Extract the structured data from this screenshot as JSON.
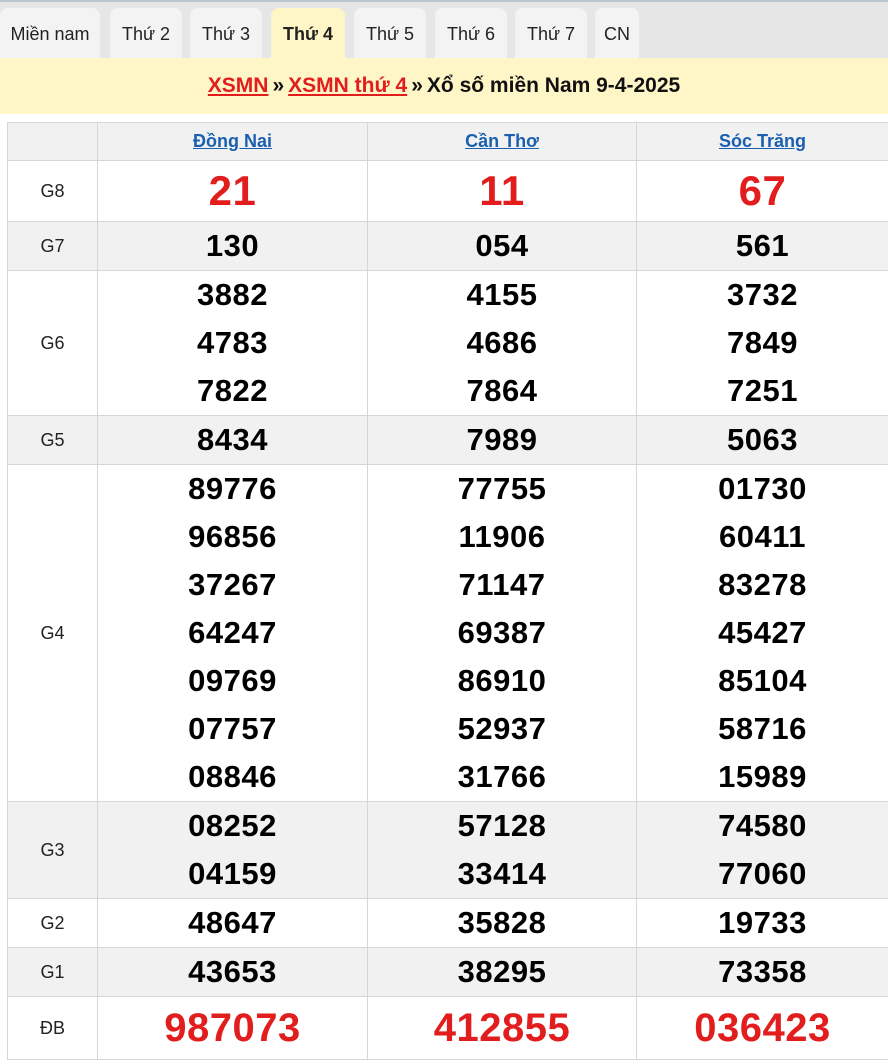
{
  "tabs": [
    {
      "label": "Miền nam",
      "active": false
    },
    {
      "label": "Thứ 2",
      "active": false
    },
    {
      "label": "Thứ 3",
      "active": false
    },
    {
      "label": "Thứ 4",
      "active": true
    },
    {
      "label": "Thứ 5",
      "active": false
    },
    {
      "label": "Thứ 6",
      "active": false
    },
    {
      "label": "Thứ 7",
      "active": false
    },
    {
      "label": "CN",
      "active": false
    }
  ],
  "title": {
    "link1": "XSMN",
    "sep1": "»",
    "link2": "XSMN thứ 4",
    "sep2": "»",
    "text": "Xổ số miền Nam 9-4-2025"
  },
  "provinces": [
    "Đồng Nai",
    "Cần Thơ",
    "Sóc Trăng"
  ],
  "prizes": [
    {
      "label": "G8",
      "style": "big-red",
      "values": [
        [
          "21"
        ],
        [
          "11"
        ],
        [
          "67"
        ]
      ]
    },
    {
      "label": "G7",
      "style": "normal",
      "values": [
        [
          "130"
        ],
        [
          "054"
        ],
        [
          "561"
        ]
      ]
    },
    {
      "label": "G6",
      "style": "normal",
      "values": [
        [
          "3882",
          "4783",
          "7822"
        ],
        [
          "4155",
          "4686",
          "7864"
        ],
        [
          "3732",
          "7849",
          "7251"
        ]
      ]
    },
    {
      "label": "G5",
      "style": "normal",
      "values": [
        [
          "8434"
        ],
        [
          "7989"
        ],
        [
          "5063"
        ]
      ]
    },
    {
      "label": "G4",
      "style": "normal",
      "values": [
        [
          "89776",
          "96856",
          "37267",
          "64247",
          "09769",
          "07757",
          "08846"
        ],
        [
          "77755",
          "11906",
          "71147",
          "69387",
          "86910",
          "52937",
          "31766"
        ],
        [
          "01730",
          "60411",
          "83278",
          "45427",
          "85104",
          "58716",
          "15989"
        ]
      ]
    },
    {
      "label": "G3",
      "style": "normal",
      "values": [
        [
          "08252",
          "04159"
        ],
        [
          "57128",
          "33414"
        ],
        [
          "74580",
          "77060"
        ]
      ]
    },
    {
      "label": "G2",
      "style": "normal",
      "values": [
        [
          "48647"
        ],
        [
          "35828"
        ],
        [
          "19733"
        ]
      ]
    },
    {
      "label": "G1",
      "style": "normal",
      "values": [
        [
          "43653"
        ],
        [
          "38295"
        ],
        [
          "73358"
        ]
      ]
    },
    {
      "label": "ĐB",
      "style": "huge-red",
      "values": [
        [
          "987073"
        ],
        [
          "412855"
        ],
        [
          "036423"
        ]
      ]
    }
  ],
  "colors": {
    "accent_red": "#e21d1d",
    "link_blue": "#1a5fb0",
    "title_bg": "#fff6c7"
  }
}
